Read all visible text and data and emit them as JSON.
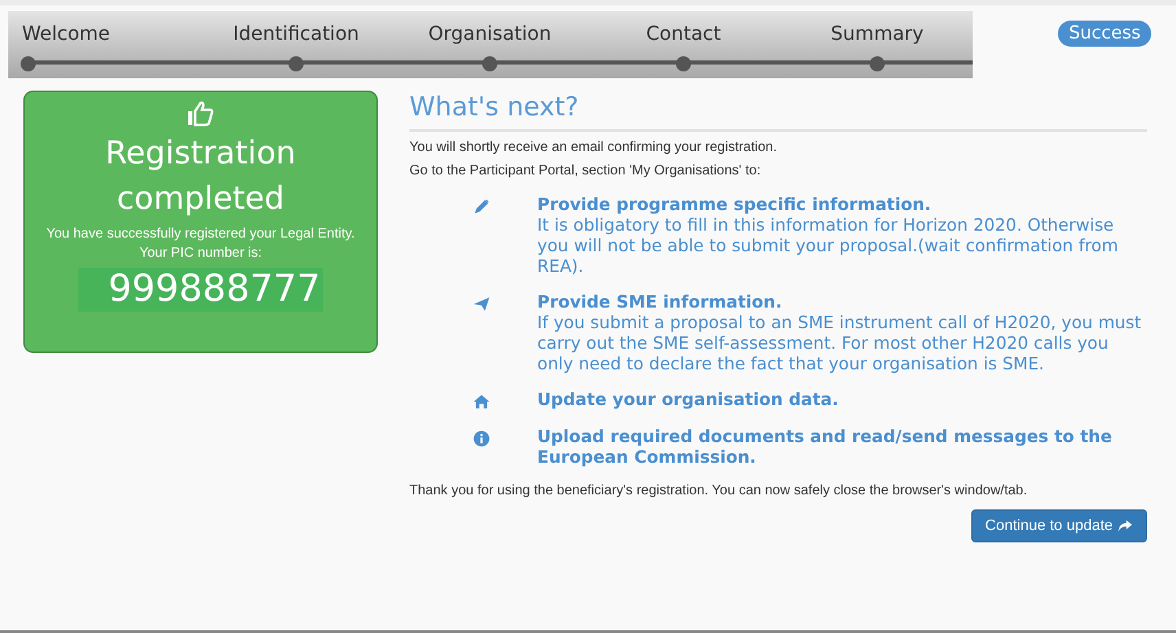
{
  "steps": [
    {
      "label": "Welcome"
    },
    {
      "label": "Identification"
    },
    {
      "label": "Organisation"
    },
    {
      "label": "Contact"
    },
    {
      "label": "Summary"
    }
  ],
  "status_badge": "Success",
  "result_card": {
    "title": "Registration completed",
    "message": "You have successfully registered your Legal Entity. Your PIC number is:",
    "pic_number": "999888777"
  },
  "next": {
    "heading": "What's next?",
    "intro": [
      "You will shortly receive an email confirming your registration.",
      "Go to the Participant Portal, section 'My Organisations' to:"
    ],
    "actions": [
      {
        "kind": "edit",
        "title": "Provide programme specific information.",
        "description": "It is obligatory to fill in this information for Horizon 2020. Otherwise you will not be able to submit your proposal.(wait confirmation from REA)."
      },
      {
        "kind": "send",
        "title": "Provide SME information.",
        "description": "If you submit a proposal to an SME instrument call of H2020, you must carry out the SME self-assessment. For most other H2020 calls you only need to declare the fact that your organisation is SME."
      },
      {
        "kind": "home",
        "title": "Update your organisation data."
      },
      {
        "kind": "info",
        "title": "Upload required documents and read/send messages to the European Commission."
      }
    ],
    "closing": "Thank you for using the beneficiary's registration. You can now safely close the browser's window/tab.",
    "button": "Continue to update"
  }
}
